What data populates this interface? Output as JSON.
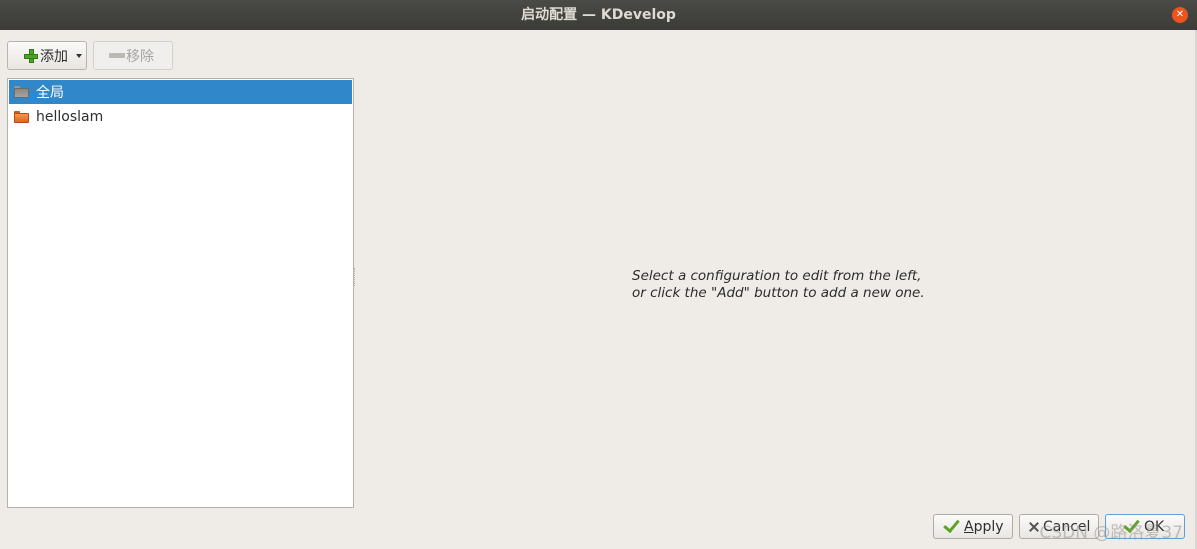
{
  "window": {
    "title": "启动配置 — KDevelop",
    "close_icon": "close-icon"
  },
  "toolbar": {
    "add_label": "添加",
    "remove_label": "移除"
  },
  "tree": {
    "items": [
      {
        "label": "全局",
        "selected": true,
        "icon": "folder-gray-icon"
      },
      {
        "label": "helloslam",
        "selected": false,
        "icon": "folder-orange-icon"
      }
    ]
  },
  "hint": {
    "line1": "Select a configuration to edit from the left,",
    "line2": "or click the \"Add\" button to add a new one."
  },
  "buttons": {
    "apply_pre": "",
    "apply_mnemonic": "A",
    "apply_post": "pply",
    "cancel_label": "Cancel",
    "ok_label": "OK"
  },
  "watermark": "CSDN @路洛夏37",
  "colors": {
    "selection": "#3087c9",
    "titlebar": "#3b3b38",
    "close": "#e9541f",
    "background": "#efebe7"
  }
}
